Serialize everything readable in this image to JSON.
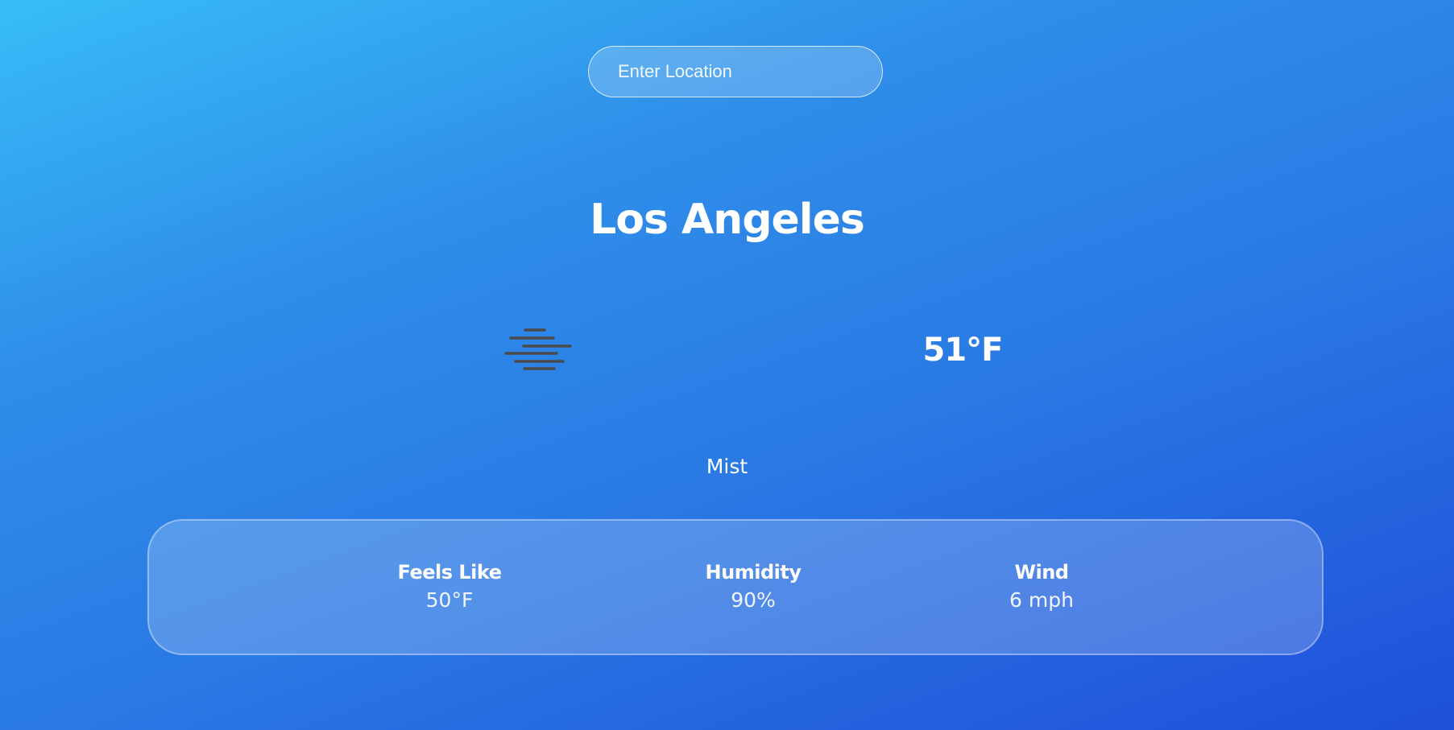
{
  "search": {
    "placeholder": "Enter Location",
    "value": ""
  },
  "location": {
    "city": "Los Angeles"
  },
  "current": {
    "icon": "mist-icon",
    "temperature": "51°F",
    "condition": "Mist"
  },
  "stats": [
    {
      "label": "Feels Like",
      "value": "50°F"
    },
    {
      "label": "Humidity",
      "value": "90%"
    },
    {
      "label": "Wind",
      "value": "6 mph"
    }
  ],
  "colors": {
    "gradient_start": "#38bdf8",
    "gradient_end": "#1e4fd9",
    "icon_gray": "#4b4b4b",
    "text": "#ffffff"
  }
}
